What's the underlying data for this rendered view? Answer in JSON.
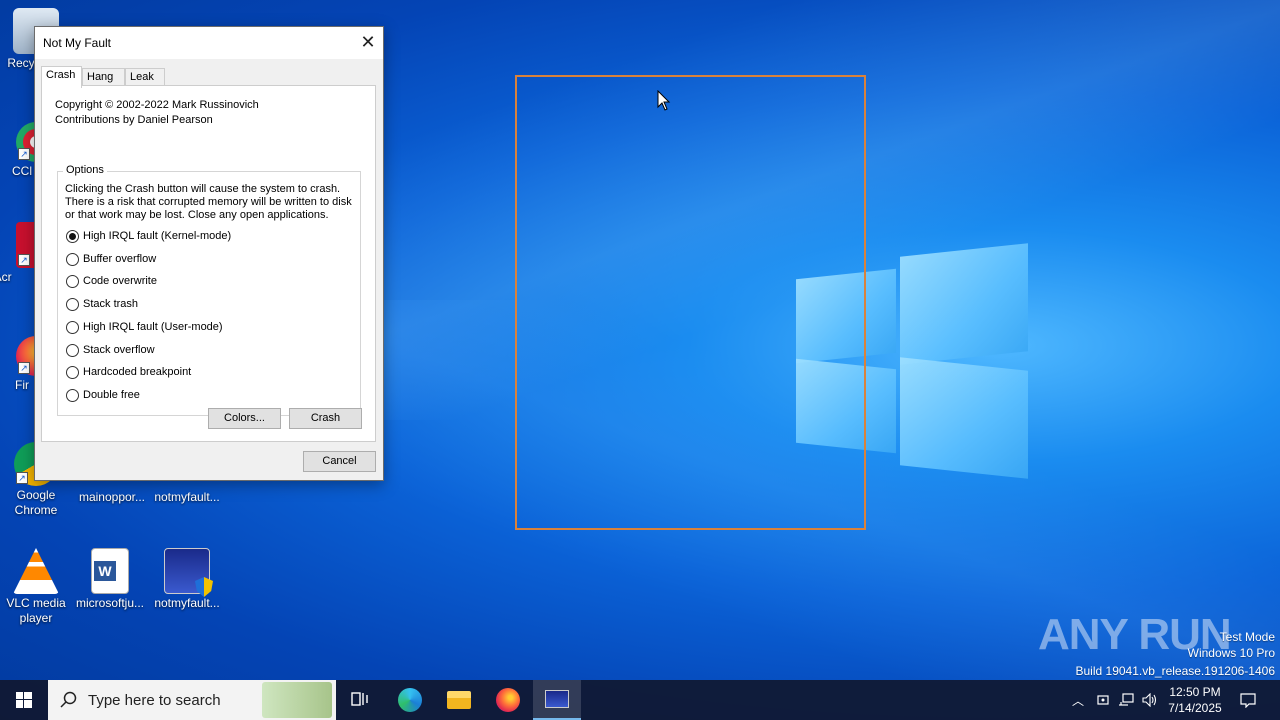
{
  "dialog": {
    "title": "Not My Fault",
    "tabs": [
      "Crash",
      "Hang",
      "Leak"
    ],
    "active_tab": "Crash",
    "copyright": "Copyright © 2002-2022 Mark Russinovich",
    "contributions": "Contributions by Daniel Pearson",
    "options_legend": "Options",
    "options_description": "Clicking the Crash button will cause the system to crash. There is a risk that corrupted memory will be written to disk or that work may be lost. Close any open applications.",
    "radio_options": [
      {
        "label": "High IRQL fault (Kernel-mode)",
        "checked": true
      },
      {
        "label": "Buffer overflow",
        "checked": false
      },
      {
        "label": "Code overwrite",
        "checked": false
      },
      {
        "label": "Stack trash",
        "checked": false
      },
      {
        "label": "High IRQL fault (User-mode)",
        "checked": false
      },
      {
        "label": "Stack overflow",
        "checked": false
      },
      {
        "label": "Hardcoded breakpoint",
        "checked": false
      },
      {
        "label": "Double free",
        "checked": false
      }
    ],
    "colors_button": "Colors...",
    "crash_button": "Crash",
    "cancel_button": "Cancel"
  },
  "desktop_icons": [
    {
      "label": "Recy",
      "icon": "recycle-bin-icon"
    },
    {
      "label": "CCl",
      "icon": "ccleaner-icon"
    },
    {
      "label": "Ad Acr",
      "icon": "acrobat-icon"
    },
    {
      "label": "Fir",
      "icon": "firefox-icon"
    },
    {
      "label": "Google Chrome",
      "icon": "chrome-icon"
    },
    {
      "label": "mainoppor...",
      "icon": "document-icon"
    },
    {
      "label": "notmyfault...",
      "icon": "notmyfault-icon"
    },
    {
      "label": "VLC media player",
      "icon": "vlc-icon"
    },
    {
      "label": "microsoftju...",
      "icon": "word-document-icon"
    },
    {
      "label": "notmyfault...",
      "icon": "notmyfault-shield-icon"
    }
  ],
  "watermark": {
    "brand": "ANY RUN",
    "line1": "Test Mode",
    "line2": "Windows 10 Pro",
    "line3": "Build 19041.vb_release.191206-1406"
  },
  "taskbar": {
    "search_placeholder": "Type here to search",
    "apps": [
      "task-view-icon",
      "edge-icon",
      "file-explorer-icon",
      "firefox-icon",
      "notmyfault-icon"
    ],
    "time": "12:50 PM",
    "date": "7/14/2025"
  },
  "colors": {
    "highlight": "#d9823b",
    "taskbar": "#101830",
    "accent": "#76b9ed"
  }
}
